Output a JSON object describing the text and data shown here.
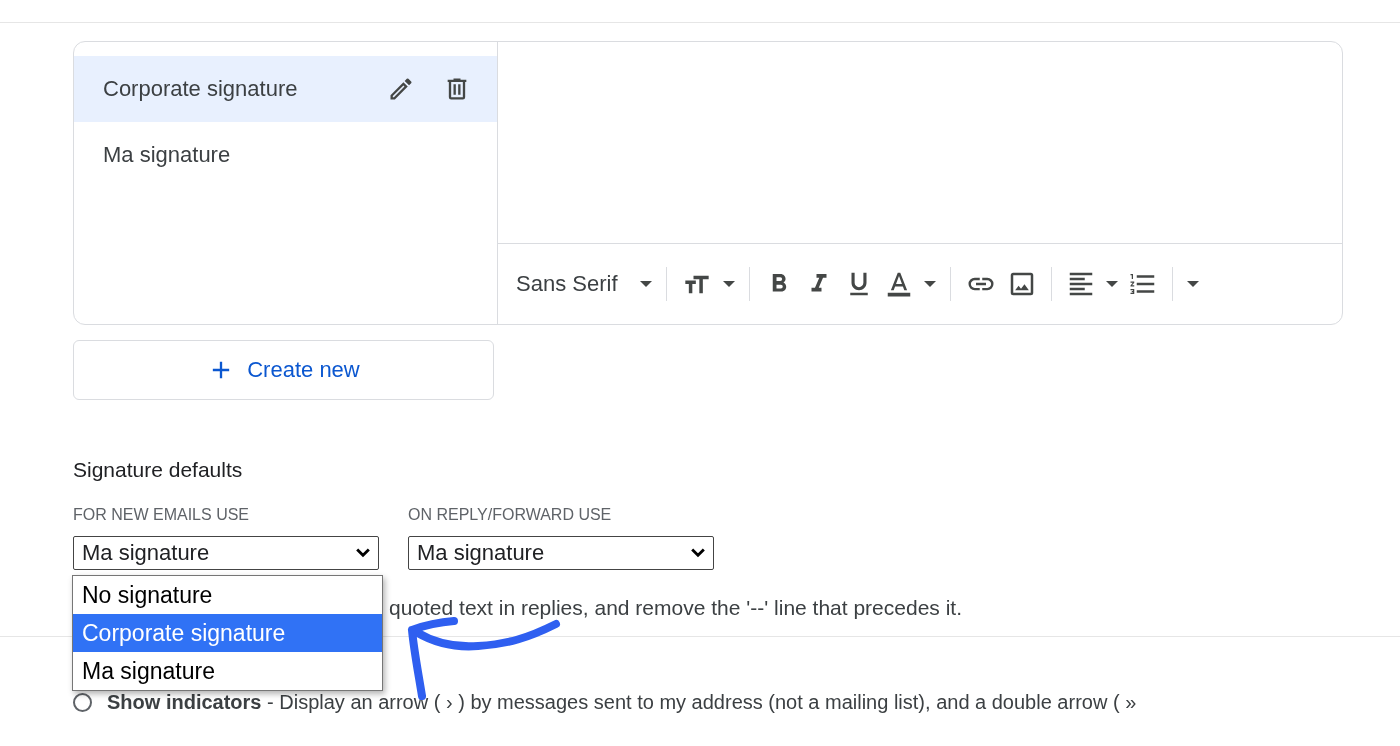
{
  "signatures": [
    {
      "name": "Corporate signature",
      "selected": true
    },
    {
      "name": "Ma signature",
      "selected": false
    }
  ],
  "editor_toolbar": {
    "font": "Sans Serif"
  },
  "create_button": "Create new",
  "defaults": {
    "title": "Signature defaults",
    "new_email": {
      "label": "FOR NEW EMAILS USE",
      "value": "Ma signature"
    },
    "reply": {
      "label": "ON REPLY/FORWARD USE",
      "value": "Ma signature"
    },
    "dropdown": [
      {
        "label": "No signature",
        "selected": false
      },
      {
        "label": "Corporate signature",
        "selected": true
      },
      {
        "label": "Ma signature",
        "selected": false
      }
    ],
    "note": "quoted text in replies, and remove the '--' line that precedes it."
  },
  "indicators": [
    {
      "label": "**Show indicators** - Display an arrow ( › ) by messages sent to my address (not a mailing list), and a double arrow ( »",
      "selected": false
    }
  ]
}
